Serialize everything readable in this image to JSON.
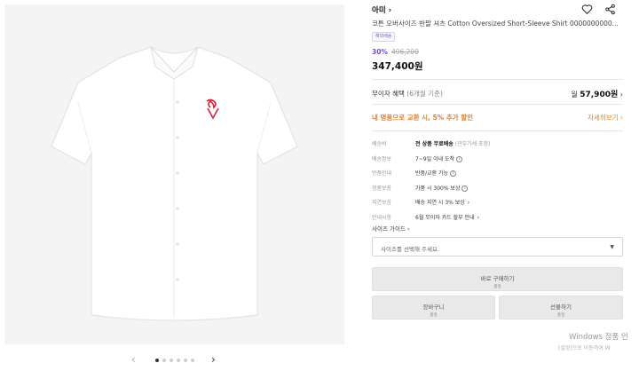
{
  "product": {
    "brand": "아미",
    "brand_chevron": "›",
    "title": "코튼 오버사이즈 반팔 셔츠 Cotton Oversized Short-Sleeve Shirt 0000000000...",
    "tag": "해외배송",
    "discount": "30%",
    "original_price": "496,200",
    "price": "347,400원"
  },
  "gallery": {
    "prev": "‹",
    "next": "›",
    "dot_count": 6,
    "active_dot": 0
  },
  "installment": {
    "label": "무이자 혜택",
    "sub": "(6개월 기준)",
    "prefix": "월",
    "amount": "57,900원",
    "chevron": "›"
  },
  "promo": {
    "text": "내 명품으로 교환 시, 5% 추가 할인",
    "link": "자세히보기 ›"
  },
  "specs": [
    {
      "key": "배송비",
      "value": "전 상품 무료배송",
      "sub": "(관부가세 포함)",
      "suffix": ""
    },
    {
      "key": "배송정보",
      "value": "7~9일 이내 도착",
      "sub": "",
      "suffix": "i"
    },
    {
      "key": "반품안내",
      "value": "반품/교환 가능",
      "sub": "",
      "suffix": "i"
    },
    {
      "key": "정품보장",
      "value": "가품 시 300% 보상",
      "sub": "",
      "suffix": "i"
    },
    {
      "key": "지연보상",
      "value": "배송 지연 시 3% 보상",
      "sub": "",
      "suffix": "›"
    },
    {
      "key": "안내사항",
      "value": "6월 무이자 카드 할부 안내",
      "sub": "",
      "suffix": "›"
    }
  ],
  "size": {
    "guide": "사이즈 가이드 ›",
    "placeholder": "사이즈를 선택해 주세요.",
    "arrow": "▼"
  },
  "buttons": {
    "buy": "바로 구매하기",
    "buy_sub": "품절",
    "cart": "장바구니",
    "cart_sub": "품절",
    "gift": "선물하기",
    "gift_sub": "품절"
  },
  "watermark": {
    "line1": "Windows 정품 인",
    "line2": "[설정]으로 이동하여 W"
  },
  "colors": {
    "accent_purple": "#7b4bd1",
    "promo_orange": "#d9822b",
    "logo_red": "#d4213d"
  },
  "icons": [
    "heart-icon",
    "share-icon",
    "info-icon",
    "chevron-right-icon",
    "dropdown-arrow-icon"
  ]
}
